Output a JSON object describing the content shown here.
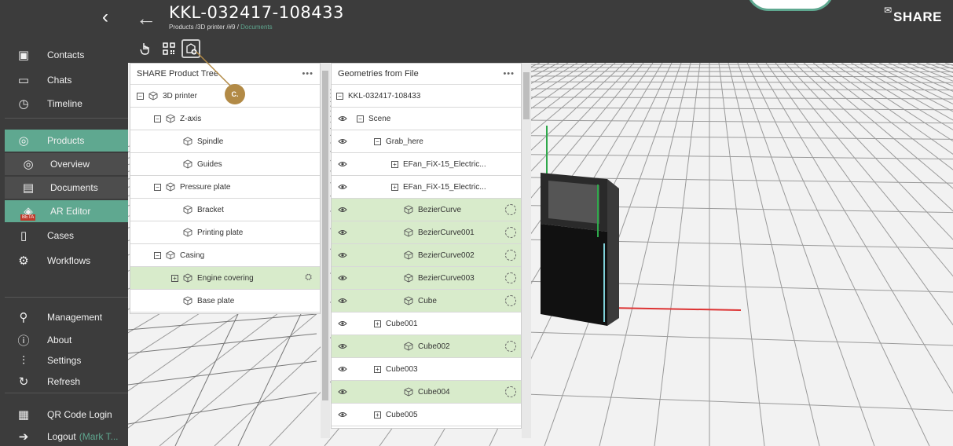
{
  "header": {
    "title": "KKL-032417-108433",
    "breadcrumb_prefix": "Products /3D printer /#9 / ",
    "breadcrumb_current": "Documents",
    "brand": "SHARE"
  },
  "sidebar": {
    "items": [
      {
        "label": "Contacts",
        "icon": "contacts-icon"
      },
      {
        "label": "Chats",
        "icon": "chat-icon"
      },
      {
        "label": "Timeline",
        "icon": "timeline-icon"
      },
      {
        "label": "Products",
        "icon": "products-icon"
      },
      {
        "label": "Overview",
        "icon": "overview-icon"
      },
      {
        "label": "Documents",
        "icon": "documents-icon"
      },
      {
        "label": "AR Editor",
        "icon": "ar-editor-icon",
        "badge": "BETA"
      },
      {
        "label": "Cases",
        "icon": "cases-icon"
      },
      {
        "label": "Workflows",
        "icon": "workflows-icon"
      },
      {
        "label": "Management",
        "icon": "management-icon"
      },
      {
        "label": "About",
        "icon": "about-icon"
      },
      {
        "label": "Settings",
        "icon": "settings-icon"
      },
      {
        "label": "Refresh",
        "icon": "refresh-icon"
      },
      {
        "label": "QR Code Login",
        "icon": "qr-code-icon"
      },
      {
        "label": "Logout",
        "icon": "logout-icon",
        "user_hint": "(Mark T..."
      }
    ]
  },
  "product_tree": {
    "title": "SHARE Product Tree",
    "more": "•••",
    "callout": "C.",
    "rows": [
      {
        "label": "3D printer",
        "indent": 0,
        "expander": "⊟"
      },
      {
        "label": "Z-axis",
        "indent": 1,
        "expander": "⊟"
      },
      {
        "label": "Spindle",
        "indent": 2,
        "expander": ""
      },
      {
        "label": "Guides",
        "indent": 2,
        "expander": ""
      },
      {
        "label": "Pressure plate",
        "indent": 1,
        "expander": "⊟"
      },
      {
        "label": "Bracket",
        "indent": 2,
        "expander": ""
      },
      {
        "label": "Printing plate",
        "indent": 2,
        "expander": ""
      },
      {
        "label": "Casing",
        "indent": 1,
        "expander": "⊟"
      },
      {
        "label": "Engine covering",
        "indent": 2,
        "expander": "⊞",
        "highlighted": true
      },
      {
        "label": "Base plate",
        "indent": 2,
        "expander": ""
      }
    ]
  },
  "geometries": {
    "title": "Geometries from File",
    "more": "•••",
    "rows": [
      {
        "label": "KKL-032417-108433",
        "indent": 0,
        "expander": "⊟",
        "eye": false,
        "cube": false,
        "green": false,
        "target": false
      },
      {
        "label": "Scene",
        "indent": 0,
        "expander": "⊟",
        "eye": true,
        "cube": false,
        "green": false,
        "target": false
      },
      {
        "label": "Grab_here",
        "indent": 1,
        "expander": "⊟",
        "eye": true,
        "cube": false,
        "green": false,
        "target": false
      },
      {
        "label": "EFan_FiX-15_Electric...",
        "indent": 2,
        "expander": "⊞",
        "eye": true,
        "cube": false,
        "green": false,
        "target": false
      },
      {
        "label": "EFan_FiX-15_Electric...",
        "indent": 2,
        "expander": "⊞",
        "eye": true,
        "cube": false,
        "green": false,
        "target": false
      },
      {
        "label": "BezierCurve",
        "indent": 2,
        "expander": "",
        "eye": true,
        "cube": true,
        "green": true,
        "target": true
      },
      {
        "label": "BezierCurve001",
        "indent": 2,
        "expander": "",
        "eye": true,
        "cube": true,
        "green": true,
        "target": true
      },
      {
        "label": "BezierCurve002",
        "indent": 2,
        "expander": "",
        "eye": true,
        "cube": true,
        "green": true,
        "target": true
      },
      {
        "label": "BezierCurve003",
        "indent": 2,
        "expander": "",
        "eye": true,
        "cube": true,
        "green": true,
        "target": true
      },
      {
        "label": "Cube",
        "indent": 2,
        "expander": "",
        "eye": true,
        "cube": true,
        "green": true,
        "target": true
      },
      {
        "label": "Cube001",
        "indent": 1,
        "expander": "⊞",
        "eye": true,
        "cube": false,
        "green": false,
        "target": false
      },
      {
        "label": "Cube002",
        "indent": 2,
        "expander": "",
        "eye": true,
        "cube": true,
        "green": true,
        "target": true
      },
      {
        "label": "Cube003",
        "indent": 1,
        "expander": "⊞",
        "eye": true,
        "cube": false,
        "green": false,
        "target": false
      },
      {
        "label": "Cube004",
        "indent": 2,
        "expander": "",
        "eye": true,
        "cube": true,
        "green": true,
        "target": true
      },
      {
        "label": "Cube005",
        "indent": 1,
        "expander": "⊞",
        "eye": true,
        "cube": false,
        "green": false,
        "target": false
      }
    ]
  },
  "toolbar": {
    "tools": [
      "hand-pointer-icon",
      "qr-grid-icon",
      "add-geometry-icon"
    ]
  },
  "colors": {
    "accent": "#5fa890",
    "sidebar_bg": "#3c3c3c",
    "highlight_row": "#d8ebcb",
    "callout": "#b28a46"
  }
}
